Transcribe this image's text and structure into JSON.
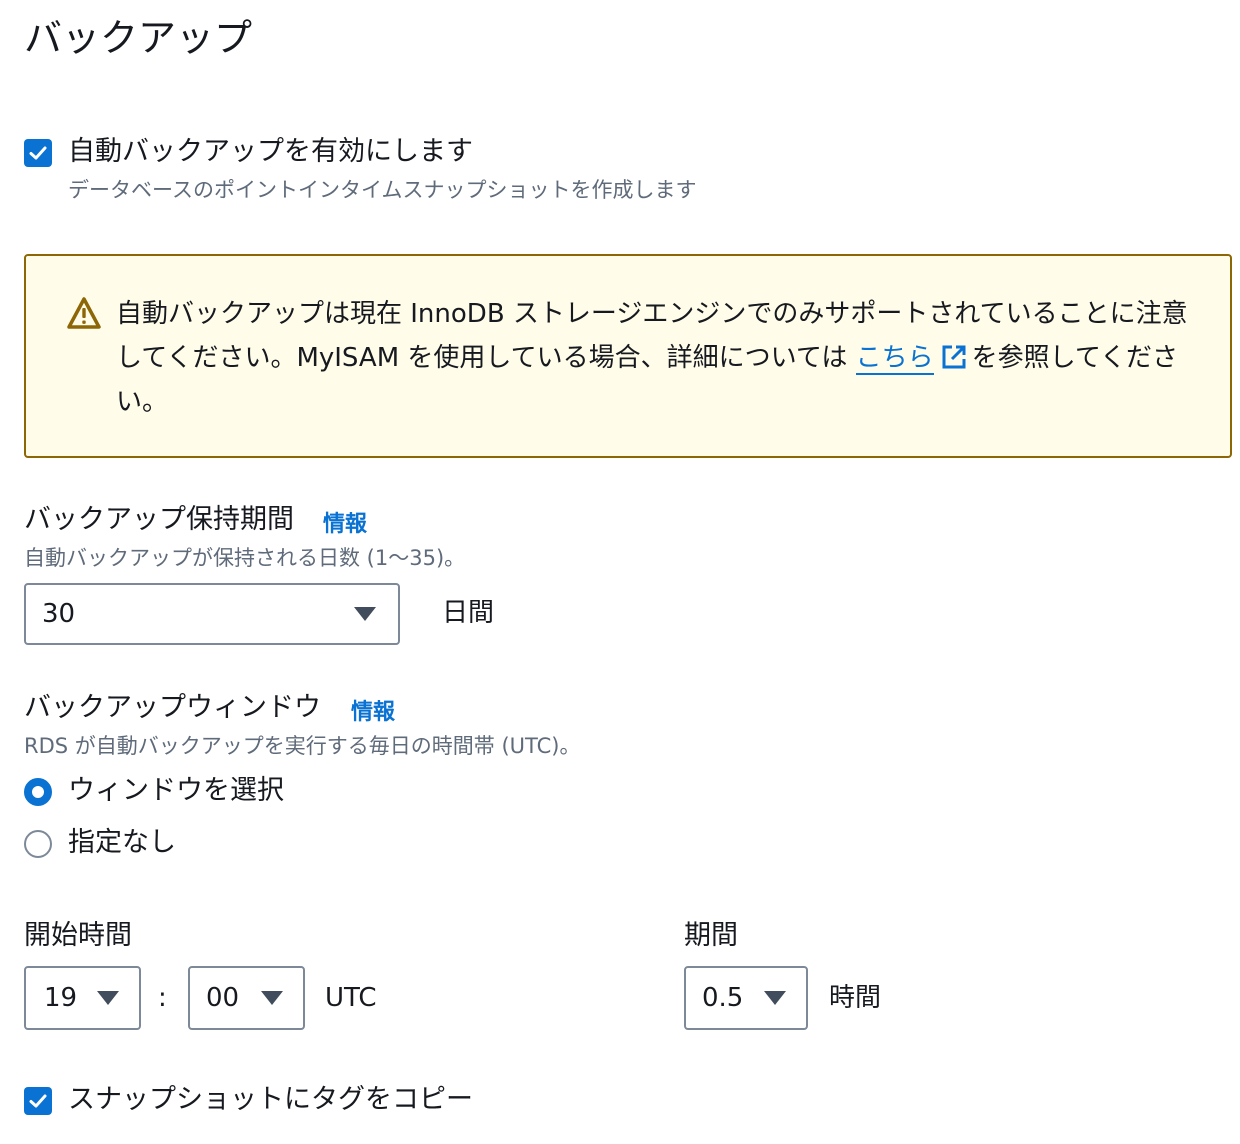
{
  "title": "バックアップ",
  "auto_backup": {
    "checked": true,
    "label": "自動バックアップを有効にします",
    "description": "データベースのポイントインタイムスナップショットを作成します"
  },
  "alert": {
    "text_before": "自動バックアップは現在 InnoDB ストレージエンジンでのみサポートされていることに注意してください。MyISAM を使用している場合、詳細については",
    "link_text": "こちら",
    "text_after": "を参照してください。",
    "icon": "warning-icon",
    "link_icon": "external-link-icon"
  },
  "retention": {
    "label": "バックアップ保持期間",
    "info": "情報",
    "description": "自動バックアップが保持される日数 (1〜35)。",
    "value": "30",
    "unit": "日間"
  },
  "window": {
    "label": "バックアップウィンドウ",
    "info": "情報",
    "description": "RDS が自動バックアップを実行する毎日の時間帯 (UTC)。",
    "options": [
      {
        "label": "ウィンドウを選択",
        "selected": true
      },
      {
        "label": "指定なし",
        "selected": false
      }
    ]
  },
  "start_time": {
    "label": "開始時間",
    "hour": "19",
    "separator": ":",
    "minute": "00",
    "tz": "UTC"
  },
  "duration": {
    "label": "期間",
    "value": "0.5",
    "unit": "時間"
  },
  "copy_tags": {
    "checked": true,
    "label": "スナップショットにタグをコピー"
  },
  "colors": {
    "accent": "#0972d3",
    "warning_border": "#8d6605",
    "warning_bg": "#fffce9",
    "secondary_text": "#5f6b7a"
  }
}
